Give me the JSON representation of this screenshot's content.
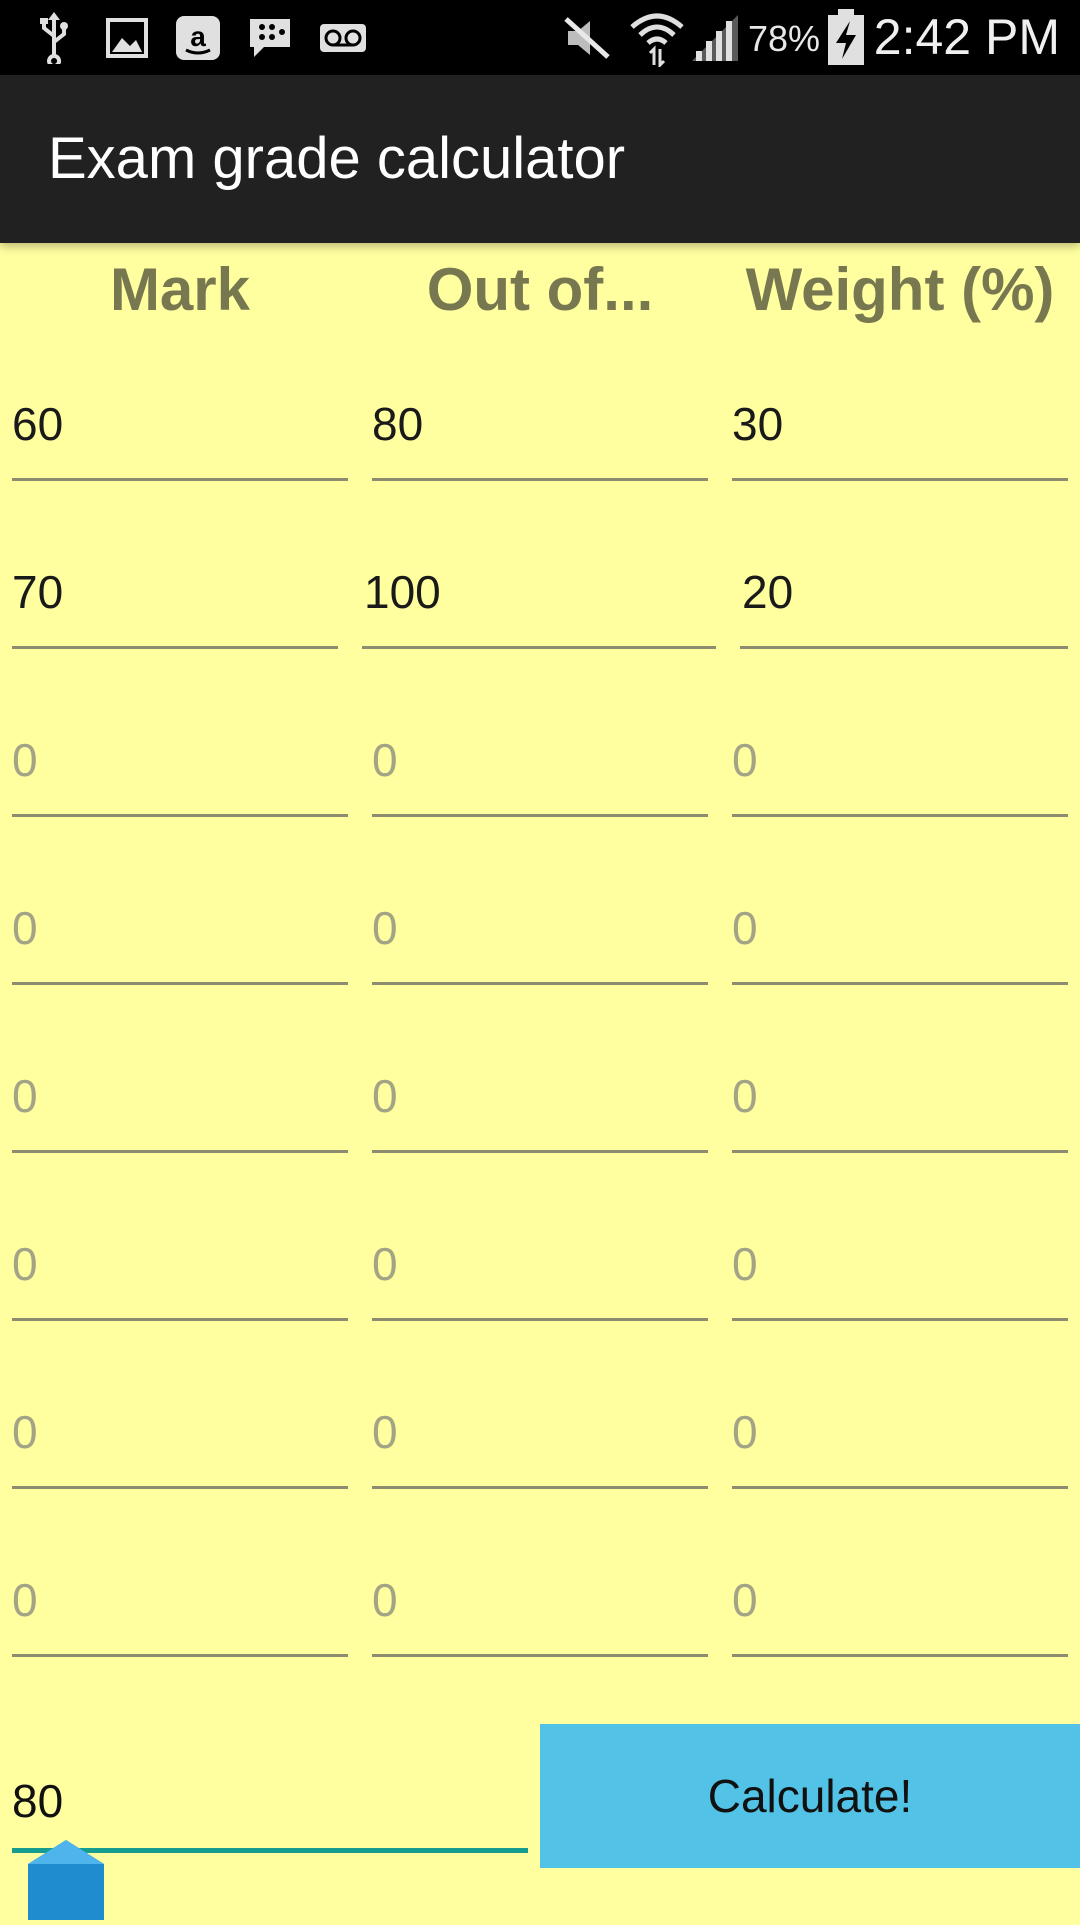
{
  "status_bar": {
    "battery_percent": "78%",
    "time": "2:42 PM",
    "icons": [
      "usb-icon",
      "image-icon",
      "amazon-icon",
      "bbm-icon",
      "voicemail-icon",
      "mute-icon",
      "wifi-icon",
      "signal-icon",
      "battery-charging-icon"
    ]
  },
  "app": {
    "title": "Exam grade calculator"
  },
  "headers": {
    "mark": "Mark",
    "out_of": "Out of...",
    "weight": "Weight (%)"
  },
  "rows": [
    {
      "mark": {
        "value": "60",
        "placeholder": "0"
      },
      "out_of": {
        "value": "80",
        "placeholder": "0"
      },
      "weight": {
        "value": "30",
        "placeholder": "0"
      }
    },
    {
      "mark": {
        "value": "70",
        "placeholder": "0"
      },
      "out_of": {
        "value": "100",
        "placeholder": "0"
      },
      "weight": {
        "value": "20",
        "placeholder": "0"
      }
    },
    {
      "mark": {
        "value": "",
        "placeholder": "0"
      },
      "out_of": {
        "value": "",
        "placeholder": "0"
      },
      "weight": {
        "value": "",
        "placeholder": "0"
      }
    },
    {
      "mark": {
        "value": "",
        "placeholder": "0"
      },
      "out_of": {
        "value": "",
        "placeholder": "0"
      },
      "weight": {
        "value": "",
        "placeholder": "0"
      }
    },
    {
      "mark": {
        "value": "",
        "placeholder": "0"
      },
      "out_of": {
        "value": "",
        "placeholder": "0"
      },
      "weight": {
        "value": "",
        "placeholder": "0"
      }
    },
    {
      "mark": {
        "value": "",
        "placeholder": "0"
      },
      "out_of": {
        "value": "",
        "placeholder": "0"
      },
      "weight": {
        "value": "",
        "placeholder": "0"
      }
    },
    {
      "mark": {
        "value": "",
        "placeholder": "0"
      },
      "out_of": {
        "value": "",
        "placeholder": "0"
      },
      "weight": {
        "value": "",
        "placeholder": "0"
      }
    },
    {
      "mark": {
        "value": "",
        "placeholder": "0"
      },
      "out_of": {
        "value": "",
        "placeholder": "0"
      },
      "weight": {
        "value": "",
        "placeholder": "0"
      }
    }
  ],
  "result": {
    "value": "80"
  },
  "calculate_button": {
    "label": "Calculate!"
  },
  "colors": {
    "background": "#ffffa0",
    "action_bar": "#212121",
    "header_text": "#777750",
    "button": "#52c2e6",
    "focus_line": "#169d8f"
  }
}
